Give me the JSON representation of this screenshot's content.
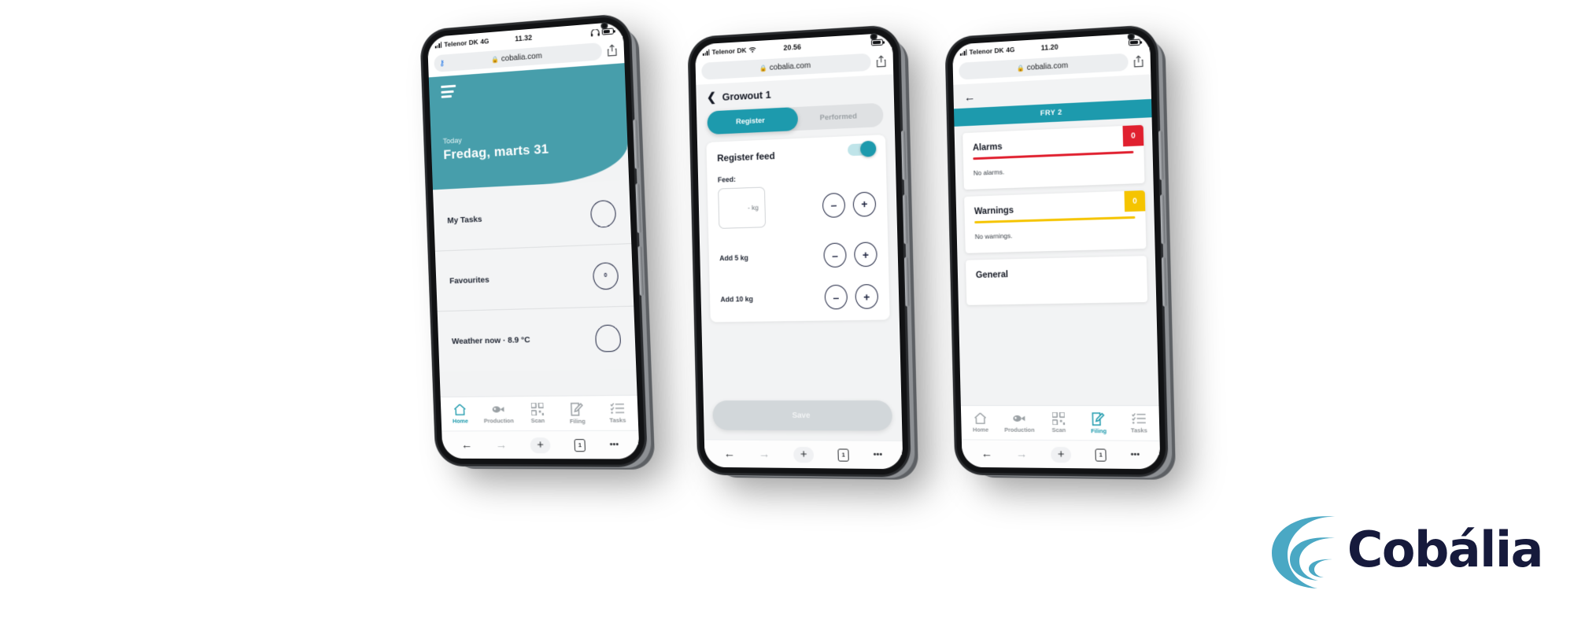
{
  "brand": {
    "name": "Cobália",
    "teal": "#479eab",
    "teal_dark": "#1d9aad",
    "navy": "#161a3c",
    "alarm_red": "#e0202f",
    "warning_yellow": "#f5c400"
  },
  "phones": [
    {
      "id": "phone-home",
      "status": {
        "carrier": "Telenor DK",
        "network": "4G",
        "time": "11.32"
      },
      "browser": {
        "url": "cobalia.com",
        "lock": "lock-icon",
        "share": "share-icon",
        "password_key": "key-icon"
      },
      "hero": {
        "menu": "hamburger-icon",
        "today_label": "Today",
        "date": "Fredag, marts 31"
      },
      "rows": [
        {
          "label": "My Tasks",
          "value": ""
        },
        {
          "label": "Favourites",
          "value": "0"
        },
        {
          "label": "Weather now · 8.9 °C",
          "value": ""
        }
      ],
      "tabs": [
        {
          "label": "Home",
          "icon": "home-icon",
          "active": true
        },
        {
          "label": "Production",
          "icon": "fish-icon",
          "active": false
        },
        {
          "label": "Scan",
          "icon": "qr-icon",
          "active": false
        },
        {
          "label": "Filing",
          "icon": "note-pencil-icon",
          "active": false
        },
        {
          "label": "Tasks",
          "icon": "checklist-icon",
          "active": false
        }
      ],
      "safari": {
        "back": "back-arrow-icon",
        "forward": "forward-arrow-icon",
        "new_tab": "+",
        "tabs_count": "1",
        "more": "•••"
      }
    },
    {
      "id": "phone-register",
      "status": {
        "carrier": "Telenor DK",
        "network": "wifi",
        "time": "20.56"
      },
      "browser": {
        "url": "cobalia.com",
        "lock": "lock-icon",
        "share": "share-icon"
      },
      "page": {
        "back": "back-chevron-icon",
        "title": "Growout 1",
        "segments": [
          {
            "label": "Register",
            "active": true
          },
          {
            "label": "Performed",
            "active": false
          }
        ],
        "card_title": "Register feed",
        "toggle_on": true,
        "feed_label": "Feed:",
        "feed_value": "- kg",
        "stepper_minus": "–",
        "stepper_plus": "+",
        "quick_adds": [
          {
            "label": "Add 5 kg"
          },
          {
            "label": "Add 10 kg"
          }
        ],
        "save_label": "Save"
      },
      "safari": {
        "back": "back-arrow-icon",
        "forward": "forward-arrow-icon",
        "new_tab": "+",
        "tabs_count": "1",
        "more": "•••"
      }
    },
    {
      "id": "phone-filing",
      "status": {
        "carrier": "Telenor DK",
        "network": "4G",
        "time": "11.20"
      },
      "browser": {
        "url": "cobalia.com",
        "lock": "lock-icon",
        "share": "share-icon"
      },
      "page": {
        "back": "back-arrow-icon",
        "unit_title": "FRY 2",
        "cards": [
          {
            "title": "Alarms",
            "count": "0",
            "body": "No alarms.",
            "color": "#e0202f"
          },
          {
            "title": "Warnings",
            "count": "0",
            "body": "No warnings.",
            "color": "#f5c400"
          },
          {
            "title": "General",
            "count": "",
            "body": "",
            "color": "#cccccc"
          }
        ]
      },
      "tabs": [
        {
          "label": "Home",
          "icon": "home-icon",
          "active": false
        },
        {
          "label": "Production",
          "icon": "fish-icon",
          "active": false
        },
        {
          "label": "Scan",
          "icon": "qr-icon",
          "active": false
        },
        {
          "label": "Filing",
          "icon": "note-pencil-icon",
          "active": true
        },
        {
          "label": "Tasks",
          "icon": "checklist-icon",
          "active": false
        }
      ],
      "safari": {
        "back": "back-arrow-icon",
        "forward": "forward-arrow-icon",
        "new_tab": "+",
        "tabs_count": "1",
        "more": "•••"
      }
    }
  ]
}
